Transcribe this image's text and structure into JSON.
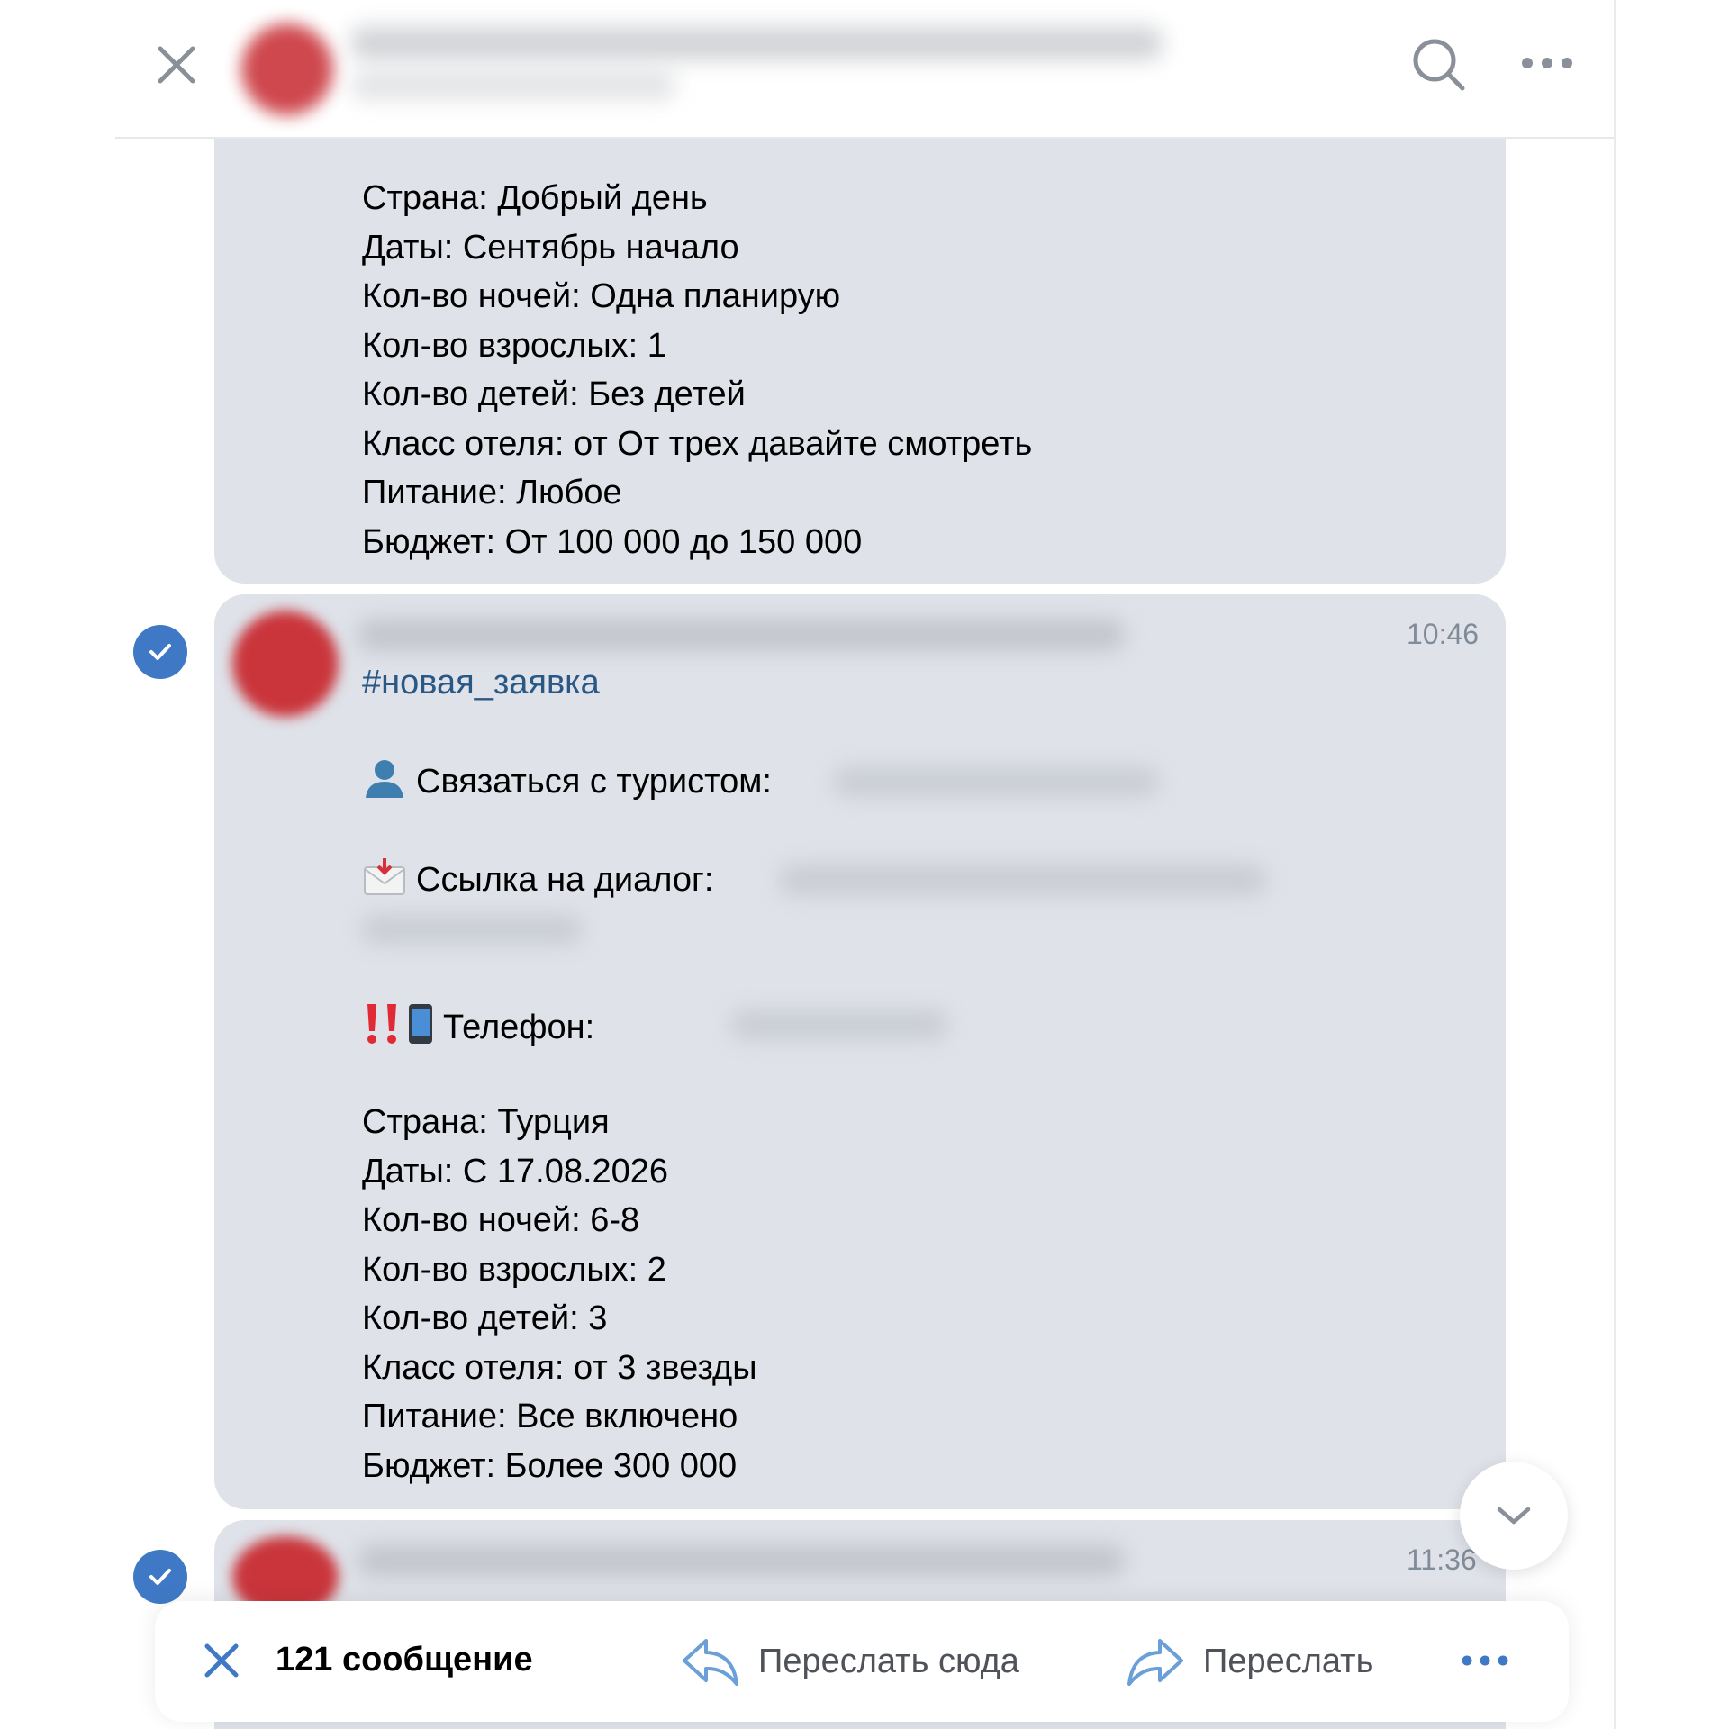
{
  "header": {
    "close_icon": "close-icon",
    "search_icon": "search-icon",
    "more_icon": "more-icon"
  },
  "messages": [
    {
      "lines": [
        "Страна: Добрый день",
        "Даты: Сентябрь начало",
        "Кол-во ночей: Одна планирую",
        "Кол-во взрослых: 1",
        "Кол-во детей: Без детей",
        "Класс отеля: от От трех давайте смотреть",
        "Питание: Любое",
        "Бюджет: От 100 000 до 150 000"
      ]
    },
    {
      "time": "10:46",
      "hashtag": "#новая_заявка",
      "contact_label": "Связаться с туристом:",
      "link_label": "Ссылка на диалог:",
      "phone_label": "Телефон:",
      "lines": [
        "Страна: Турция",
        "Даты: С 17.08.2026",
        "Кол-во ночей: 6-8",
        "Кол-во взрослых: 2",
        "Кол-во детей: 3",
        "Класс отеля: от 3 звезды",
        "Питание: Все включено",
        "Бюджет: Более 300 000"
      ]
    },
    {
      "time": "11:36"
    }
  ],
  "action_bar": {
    "count": "121 сообщение",
    "forward_here": "Переслать сюда",
    "forward": "Переслать"
  },
  "colors": {
    "accent": "#3f79c6",
    "bubble": "#dfe2e9",
    "hashtag": "#2a5885"
  }
}
